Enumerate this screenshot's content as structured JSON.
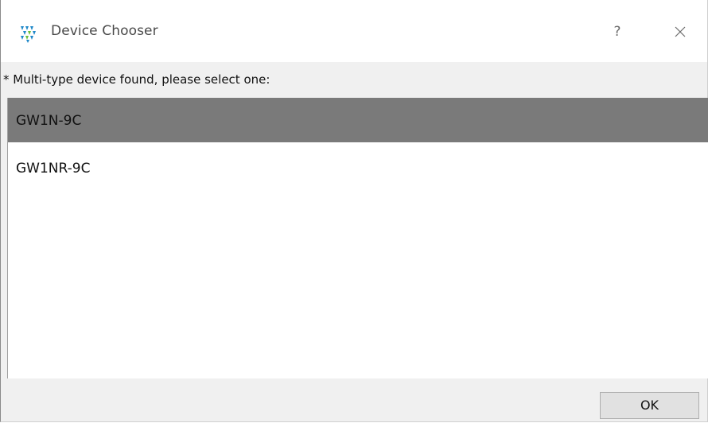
{
  "window": {
    "title": "Device Chooser",
    "help_label": "?",
    "app_icon": "gowin-logo-icon",
    "close_icon": "close-icon"
  },
  "prompt": "* Multi-type device found, please select one:",
  "devices": [
    {
      "label": "GW1N-9C",
      "selected": true
    },
    {
      "label": "GW1NR-9C",
      "selected": false
    }
  ],
  "footer": {
    "ok_label": "OK"
  },
  "colors": {
    "selected_row": "#7a7a7a",
    "icon_blue": "#1f88c9",
    "icon_green": "#6cbf3a"
  }
}
